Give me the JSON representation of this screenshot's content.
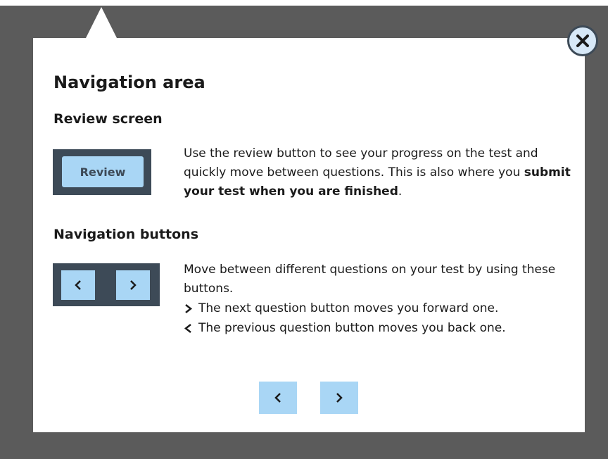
{
  "dialog": {
    "title": "Navigation area",
    "close_label": "Close"
  },
  "review_section": {
    "heading": "Review screen",
    "button_label": "Review",
    "text_plain": "Use the review button to see your progress on the test and quickly move between questions. This is also where you ",
    "text_bold": "submit your test when you are finished",
    "text_end": "."
  },
  "navigation_section": {
    "heading": "Navigation buttons",
    "text": "Move between different questions on your test by using these buttons.",
    "bullets": [
      {
        "icon": "chevron-right-icon",
        "text": "The next question button moves you forward one."
      },
      {
        "icon": "chevron-left-icon",
        "text": "The previous question button moves you back one."
      }
    ]
  },
  "footer": {
    "prev_icon": "chevron-left-icon",
    "next_icon": "chevron-right-icon"
  },
  "colors": {
    "overlay": "#5b5b5b",
    "panel": "#ffffff",
    "dark": "#3d4a57",
    "button": "#a9d6f5"
  }
}
